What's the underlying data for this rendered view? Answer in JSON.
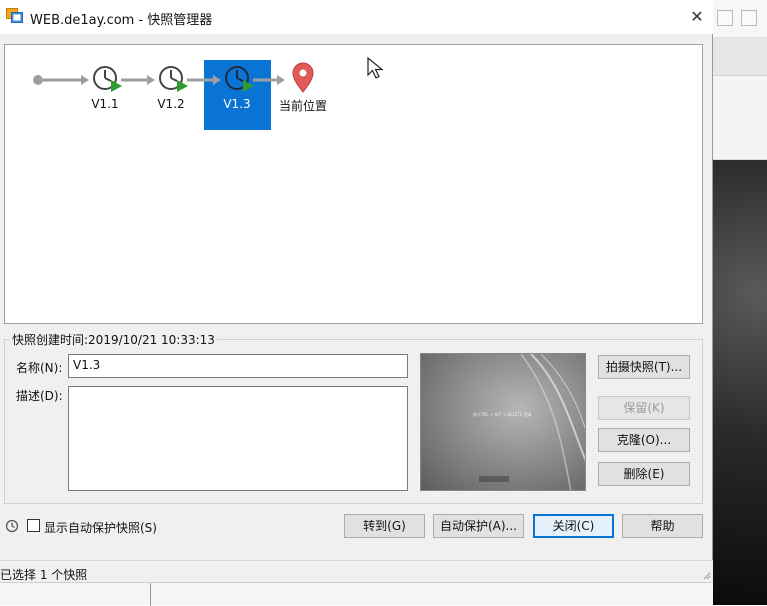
{
  "window": {
    "title": "WEB.de1ay.com - 快照管理器",
    "close_glyph": "✕"
  },
  "snapshot_tree": {
    "nodes": [
      {
        "label": "V1.1",
        "icon": "snapshot-clock-icon"
      },
      {
        "label": "V1.2",
        "icon": "snapshot-clock-icon"
      },
      {
        "label": "V1.3",
        "icon": "snapshot-clock-icon",
        "selected": true
      },
      {
        "label": "当前位置",
        "icon": "location-pin-icon"
      }
    ]
  },
  "details": {
    "created_label": "快照创建时间:2019/10/21 10:33:13",
    "name_label": "名称(N):",
    "name_value": "V1.3",
    "desc_label": "描述(D):",
    "desc_value": "",
    "thumbnail_text": "按 CTRL + ALT + DELETE 登录"
  },
  "actions": {
    "take_snapshot": "拍摄快照(T)...",
    "keep": "保留(K)",
    "clone": "克隆(O)...",
    "delete": "删除(E)"
  },
  "footer": {
    "show_autoprotect_label": "显示自动保护快照(S)",
    "show_autoprotect_checked": false,
    "goto": "转到(G)",
    "autoprotect": "自动保护(A)...",
    "close": "关闭(C)",
    "help": "帮助"
  },
  "status": {
    "text": "已选择 1 个快照"
  },
  "colors": {
    "selection": "#0a74d4",
    "clock_green": "#2e9c2e",
    "pin_red": "#e05a5a",
    "connector": "#9e9e9e"
  }
}
